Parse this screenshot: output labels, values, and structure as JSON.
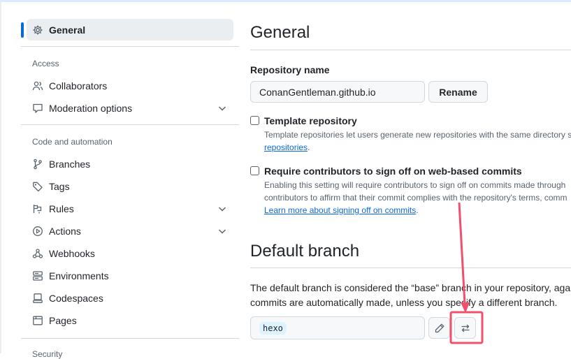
{
  "sidebar": {
    "general": "General",
    "sections": {
      "access": "Access",
      "code": "Code and automation",
      "security": "Security"
    },
    "items": {
      "collaborators": "Collaborators",
      "moderation": "Moderation options",
      "branches": "Branches",
      "tags": "Tags",
      "rules": "Rules",
      "actions": "Actions",
      "webhooks": "Webhooks",
      "environments": "Environments",
      "codespaces": "Codespaces",
      "pages": "Pages"
    }
  },
  "main": {
    "title": "General",
    "repo_name_label": "Repository name",
    "repo_name_value": "ConanGentleman.github.io",
    "rename_button": "Rename",
    "template": {
      "label": "Template repository",
      "desc_line1": "Template repositories let users generate new repositories with the same directory s",
      "desc_link": "repositories",
      "desc_tail": "."
    },
    "signoff": {
      "label": "Require contributors to sign off on web-based commits",
      "desc_line1": "Enabling this setting will require contributors to sign off on commits made through",
      "desc_line2": "contributors to affirm that their commit complies with the repository's terms, comm",
      "desc_link": "Learn more about signing off on commits",
      "desc_tail": "."
    },
    "default_branch": {
      "title": "Default branch",
      "desc_line1": "The default branch is considered the “base” branch in your repository, agai",
      "desc_line2": "commits are automatically made, unless you specify a different branch.",
      "branch": "hexo"
    }
  },
  "colors": {
    "accent": "#0969da",
    "annotation": "#f0506e"
  }
}
